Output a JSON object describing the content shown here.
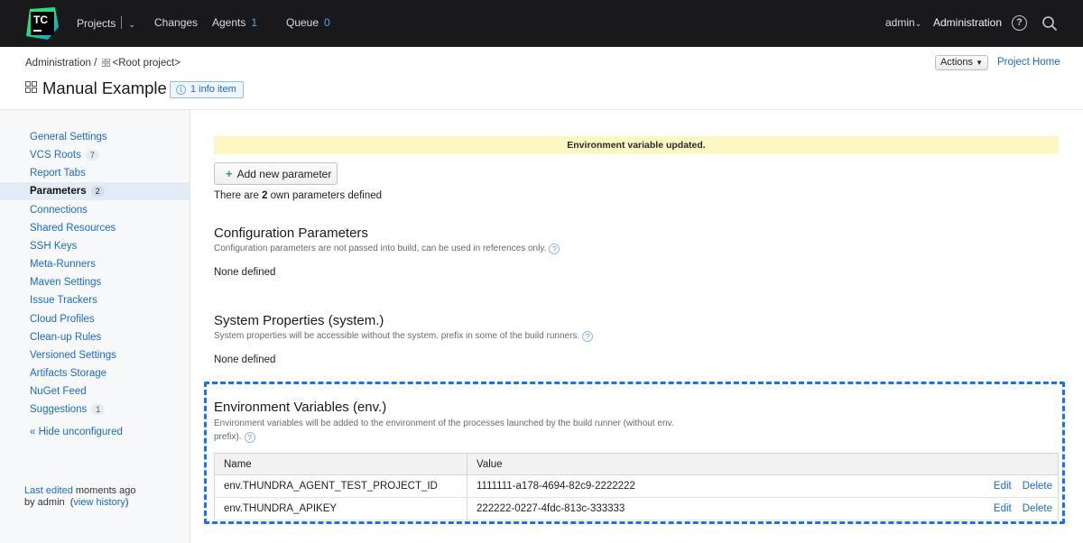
{
  "topbar": {
    "logo_text": "TC",
    "projects": "Projects",
    "changes": "Changes",
    "agents": "Agents",
    "agents_count": "1",
    "queue": "Queue",
    "queue_count": "0",
    "user": "admin",
    "administration": "Administration",
    "help_glyph": "?"
  },
  "header": {
    "breadcrumb_admin": "Administration",
    "breadcrumb_sep": "/",
    "breadcrumb_root": "<Root project>",
    "title": "Manual Example",
    "info_badge": "1 info item",
    "actions": "Actions",
    "project_home": "Project Home"
  },
  "sidebar": {
    "items": [
      {
        "label": "General Settings",
        "count": ""
      },
      {
        "label": "VCS Roots",
        "count": "7"
      },
      {
        "label": "Report Tabs",
        "count": ""
      },
      {
        "label": "Parameters",
        "count": "2",
        "active": true
      },
      {
        "label": "Connections",
        "count": ""
      },
      {
        "label": "Shared Resources",
        "count": ""
      },
      {
        "label": "SSH Keys",
        "count": ""
      },
      {
        "label": "Meta-Runners",
        "count": ""
      },
      {
        "label": "Maven Settings",
        "count": ""
      },
      {
        "label": "Issue Trackers",
        "count": ""
      },
      {
        "label": "Cloud Profiles",
        "count": ""
      },
      {
        "label": "Clean-up Rules",
        "count": ""
      },
      {
        "label": "Versioned Settings",
        "count": ""
      },
      {
        "label": "Artifacts Storage",
        "count": ""
      },
      {
        "label": "NuGet Feed",
        "count": ""
      },
      {
        "label": "Suggestions",
        "count": "1"
      }
    ],
    "hide_unconfigured": "« Hide unconfigured",
    "last_edited_link": "Last edited",
    "last_edited_when": " moments ago",
    "by_admin": "by admin",
    "view_history": "view history"
  },
  "main": {
    "notice": "Environment variable updated.",
    "add_button": "Add new parameter",
    "own_params_prefix": "There are ",
    "own_params_count": "2",
    "own_params_suffix": " own parameters defined",
    "config": {
      "title": "Configuration Parameters",
      "desc": "Configuration parameters are not passed into build, can be used in references only.",
      "none": "None defined"
    },
    "system": {
      "title": "System Properties (system.)",
      "desc": "System properties will be accessible without the system. prefix in some of the build runners.",
      "none": "None defined"
    },
    "env": {
      "title": "Environment Variables (env.)",
      "desc_line1": "Environment variables will be added to the environment of the processes launched by the build runner (without env.",
      "desc_line2": "prefix).",
      "columns": [
        "Name",
        "Value"
      ],
      "rows": [
        {
          "name": "env.THUNDRA_AGENT_TEST_PROJECT_ID",
          "value": "1111111-a178-4694-82c9-2222222",
          "edit": "Edit",
          "delete": "Delete"
        },
        {
          "name": "env.THUNDRA_APIKEY",
          "value": "222222-0227-4fdc-813c-333333",
          "edit": "Edit",
          "delete": "Delete"
        }
      ]
    }
  },
  "colors": {
    "topbar_bg": "#19191c",
    "link": "#1b69c9",
    "highlight_dash": "#1a73e8",
    "notice_bg": "#fdf7c4"
  }
}
